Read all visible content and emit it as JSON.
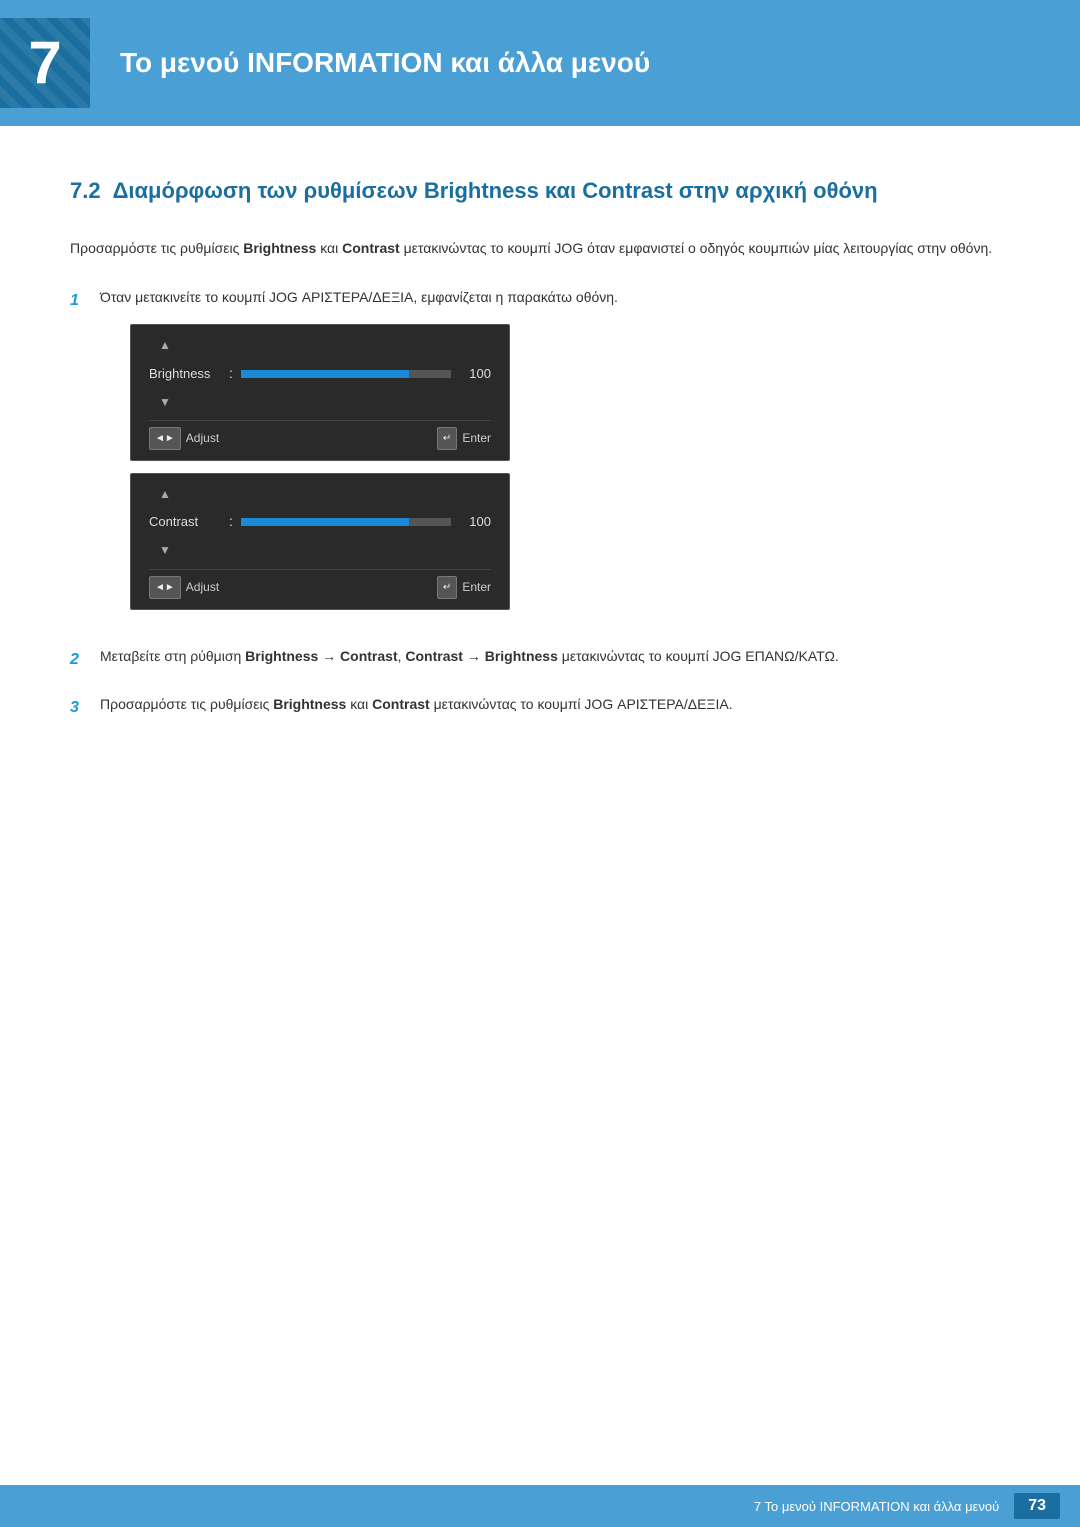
{
  "header": {
    "chapter_number": "7",
    "title": "Το μενού INFORMATION και άλλα μενού"
  },
  "section": {
    "number": "7.2",
    "title": "Διαμόρφωση των ρυθμίσεων Brightness και Contrast στην αρχική οθόνη"
  },
  "body_intro": "Προσαρμόστε τις ρυθμίσεις Brightness και Contrast μετακινώντας το κουμπί JOG όταν εμφανιστεί ο οδηγός κουμπιών μίας λειτουργίας στην οθόνη.",
  "steps": [
    {
      "number": "1",
      "text": "Όταν μετακινείτε το κουμπί JOG ΑΡΙΣΤΕΡΑ/ΔΕΞΙΑ, εμφανίζεται η παρακάτω οθόνη."
    },
    {
      "number": "2",
      "text_parts": [
        "Μεταβείτε στη ρύθμιση ",
        "Brightness",
        " → ",
        "Contrast",
        ", ",
        "Contrast",
        " → ",
        "Brightness",
        " μετακινώντας το κουμπί JOG ΕΠΑΝΩ/ΚΑΤΩ."
      ]
    },
    {
      "number": "3",
      "text_parts": [
        "Προσαρμόστε τις ρυθμίσεις ",
        "Brightness",
        " και ",
        "Contrast",
        " μετακινώντας το κουμπί JOG ΑΡΙΣΤΕΡΑ/ΔΕΞΙΑ."
      ]
    }
  ],
  "osd": {
    "brightness_panel": {
      "label": "Brightness",
      "value": "100",
      "fill_percent": 80,
      "adjust_label": "Adjust",
      "enter_label": "Enter"
    },
    "contrast_panel": {
      "label": "Contrast",
      "value": "100",
      "fill_percent": 80,
      "adjust_label": "Adjust",
      "enter_label": "Enter"
    }
  },
  "footer": {
    "text": "7 Το μενού INFORMATION και άλλα μενού",
    "page_number": "73"
  }
}
